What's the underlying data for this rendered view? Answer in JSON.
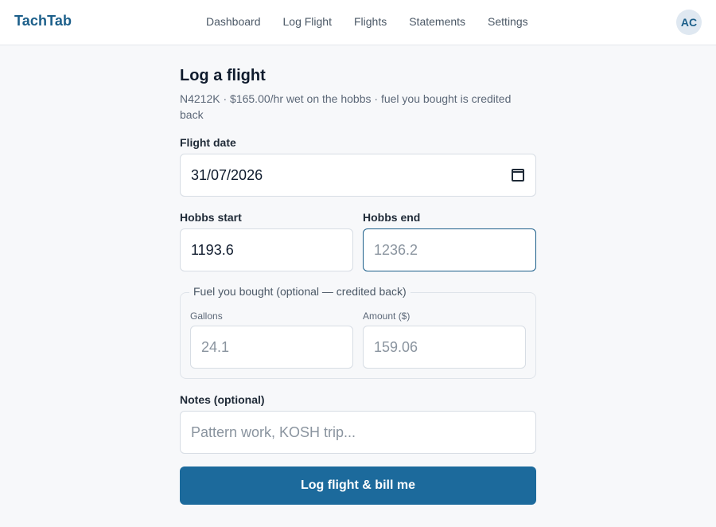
{
  "app": {
    "brand": "TachTab"
  },
  "nav": {
    "items": [
      {
        "label": "Dashboard"
      },
      {
        "label": "Log Flight"
      },
      {
        "label": "Flights"
      },
      {
        "label": "Statements"
      },
      {
        "label": "Settings"
      }
    ]
  },
  "user": {
    "initials": "AC"
  },
  "form": {
    "title": "Log a flight",
    "subtitle": "N4212K · $165.00/hr wet on the hobbs · fuel you bought is credited back",
    "flight_date": {
      "label": "Flight date",
      "value": "31/07/2026"
    },
    "hobbs_start": {
      "label": "Hobbs start",
      "value": "1193.6"
    },
    "hobbs_end": {
      "label": "Hobbs end",
      "value": "",
      "placeholder": "1236.2"
    },
    "fuel": {
      "legend": "Fuel you bought (optional — credited back)",
      "gallons": {
        "label": "Gallons",
        "value": "",
        "placeholder": "24.1"
      },
      "amount": {
        "label": "Amount ($)",
        "value": "",
        "placeholder": "159.06"
      }
    },
    "notes": {
      "label": "Notes (optional)",
      "value": "",
      "placeholder": "Pattern work, KOSH trip..."
    },
    "submit_label": "Log flight & bill me"
  },
  "colors": {
    "accent": "#1c6a9c",
    "brand": "#1c5f8a",
    "background": "#f7f8fa"
  }
}
